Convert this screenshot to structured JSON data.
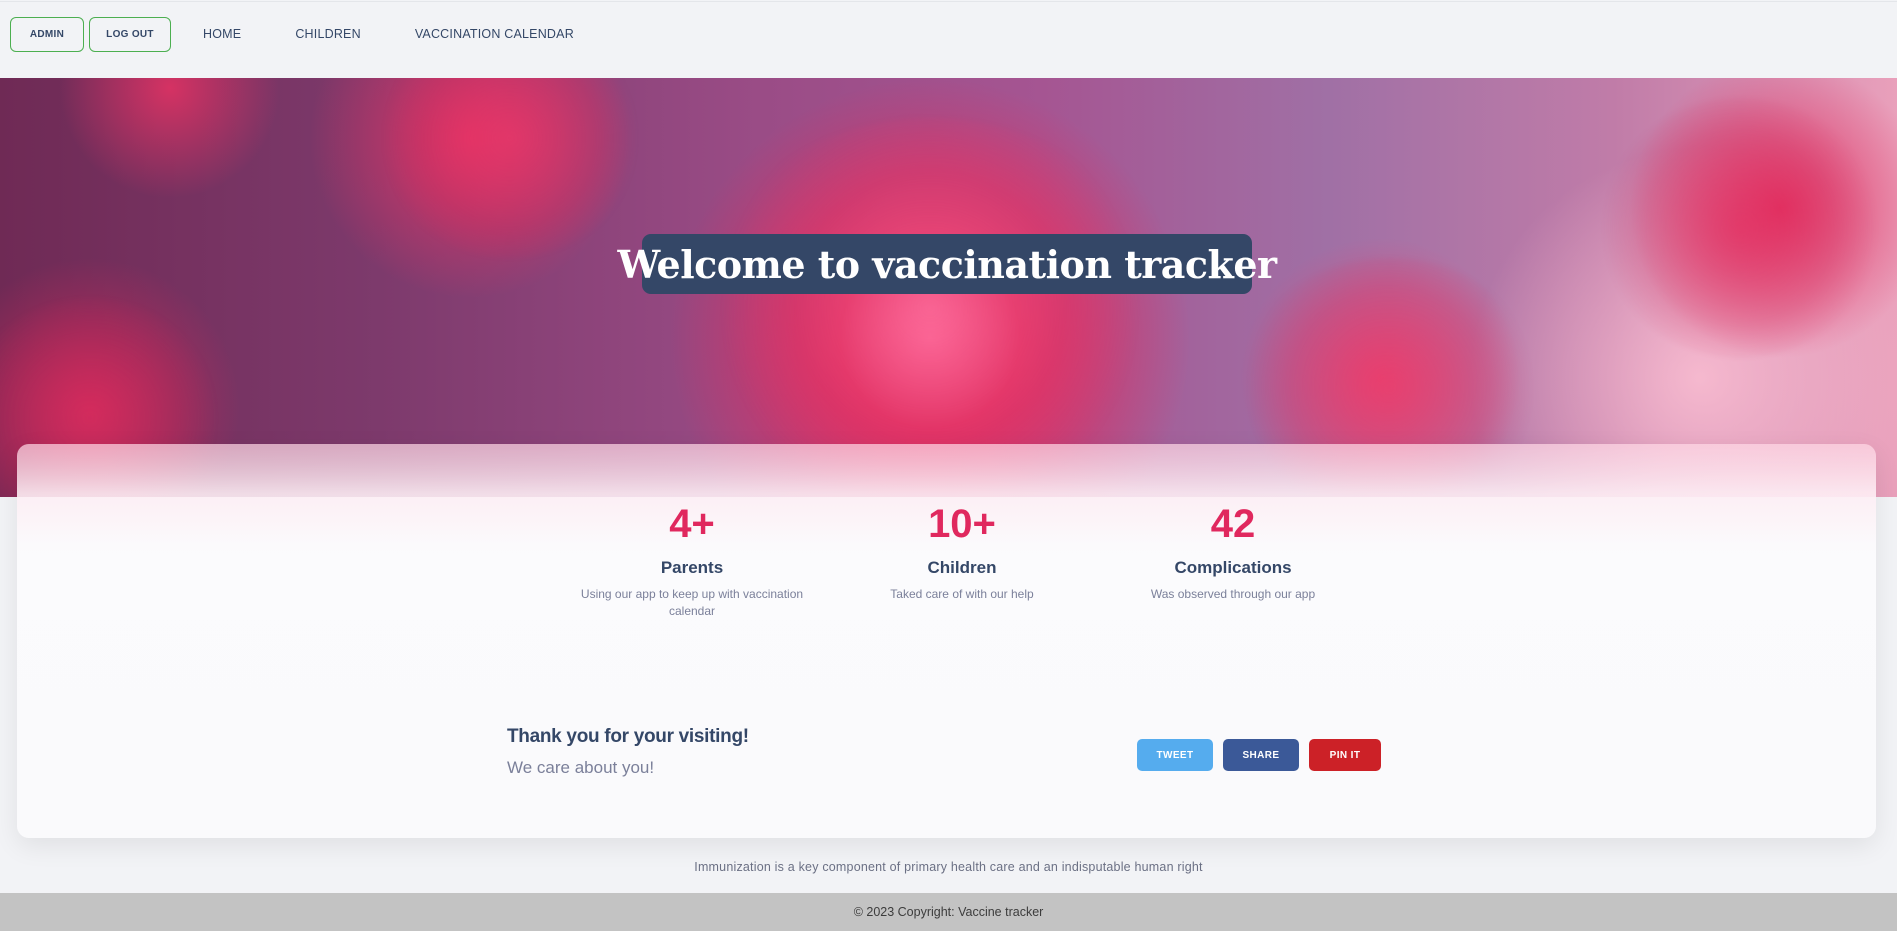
{
  "navbar": {
    "admin_label": "ADMIN",
    "logout_label": "LOG OUT",
    "links": [
      "HOME",
      "CHILDREN",
      "VACCINATION CALENDAR"
    ]
  },
  "hero": {
    "title": "Welcome to vaccination tracker"
  },
  "stats": [
    {
      "number": "4+",
      "title": "Parents",
      "description": "Using our app to keep up with vaccination calendar"
    },
    {
      "number": "10+",
      "title": "Children",
      "description": "Taked care of with our help"
    },
    {
      "number": "42",
      "title": "Complications",
      "description": "Was observed through our app"
    }
  ],
  "thanks": {
    "title": "Thank you for your visiting!",
    "subtitle": "We care about you!"
  },
  "social": {
    "tweet_label": "TWEET",
    "share_label": "SHARE",
    "pin_label": "PIN IT"
  },
  "tagline": "Immunization is a key component of primary health care and an indisputable human right",
  "footer": {
    "copyright": "© 2023 Copyright: Vaccine tracker"
  },
  "colors": {
    "accent_number": "#e0285e",
    "navbar_border": "#4caf50",
    "title_box": "#344767",
    "tweet": "#55acee",
    "share": "#3b5998",
    "pin": "#cc2127"
  }
}
